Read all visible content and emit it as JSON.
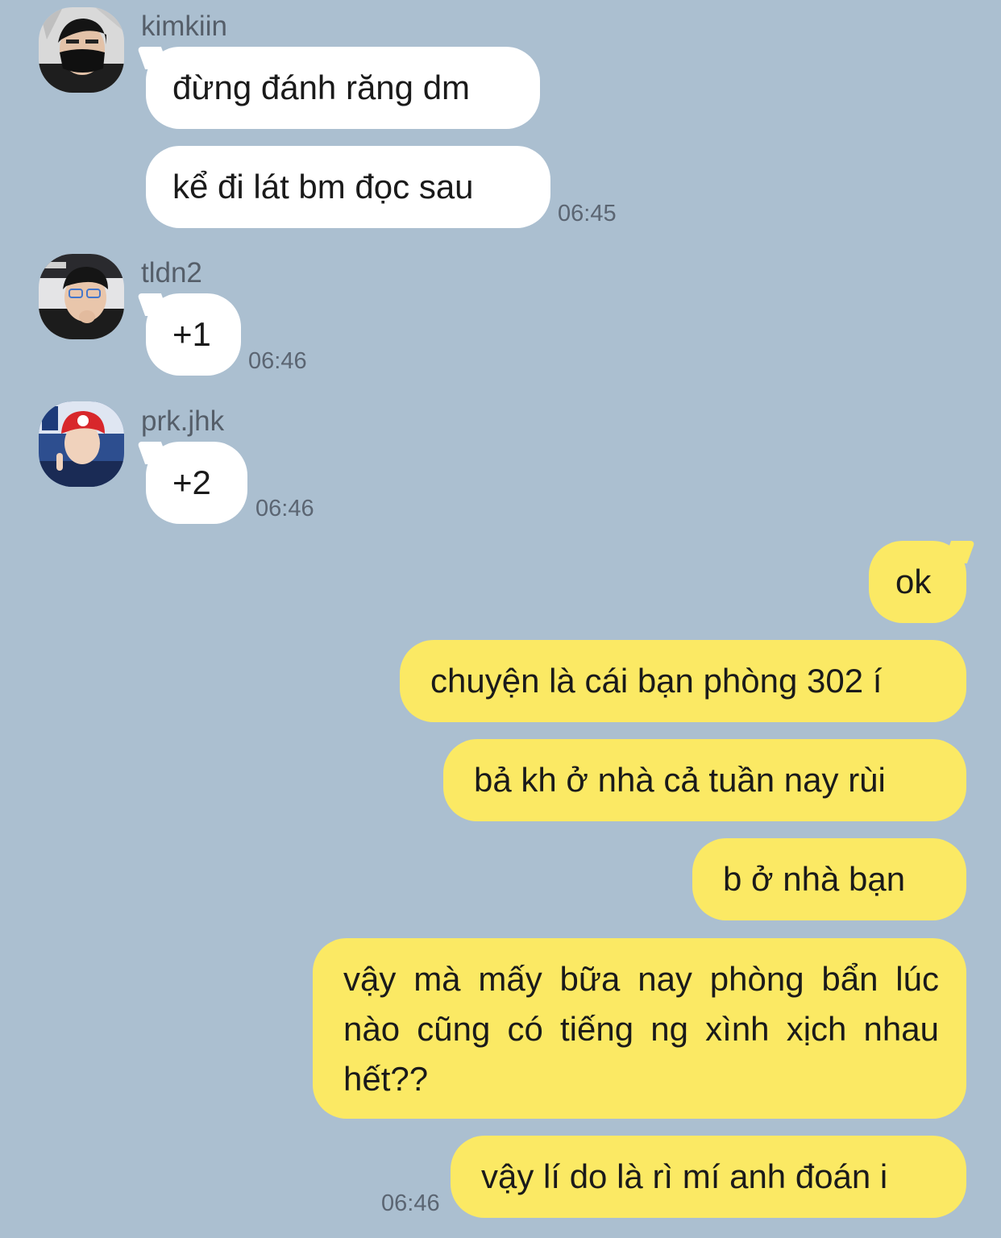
{
  "chat": {
    "groups": [
      {
        "sender": "kimkiin",
        "avatar_icon": "avatar-kimkiin",
        "messages": [
          "đừng đánh răng dm",
          "kể đi lát bm đọc sau"
        ],
        "time": "06:45"
      },
      {
        "sender": "tldn2",
        "avatar_icon": "avatar-tldn2",
        "messages": [
          "+1"
        ],
        "time": "06:46"
      },
      {
        "sender": "prk.jhk",
        "avatar_icon": "avatar-prkjhk",
        "messages": [
          "+2"
        ],
        "time": "06:46"
      }
    ],
    "outgoing": {
      "messages": [
        "ok",
        "chuyện là cái bạn phòng 302 í",
        "bả kh ở nhà cả tuần nay rùi",
        "b ở nhà bạn",
        "vậy mà mấy bữa nay phòng bẩn lúc nào cũng có tiếng ng xình xịch nhau hết??",
        "vậy lí do là rì mí anh đoán i"
      ],
      "time": "06:46"
    }
  },
  "colors": {
    "background": "#abbfd0",
    "incoming_bubble": "#ffffff",
    "outgoing_bubble": "#fbe964",
    "text": "#1a1a1a",
    "meta_text": "#555e69"
  }
}
